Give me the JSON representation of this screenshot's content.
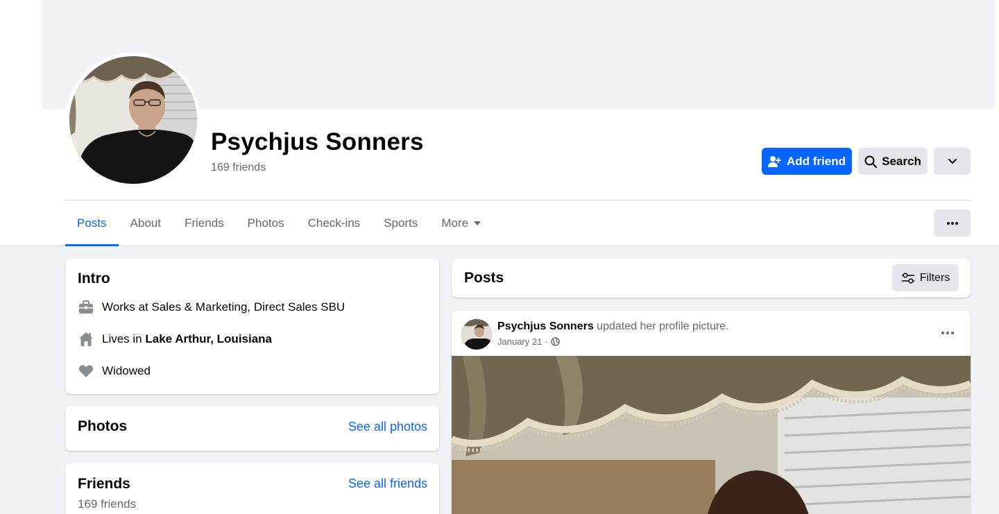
{
  "profile": {
    "name": "Psychjus Sonners",
    "friends_count": "169 friends"
  },
  "actions": {
    "add_friend": "Add friend",
    "search": "Search"
  },
  "tabs": [
    {
      "label": "Posts",
      "active": true
    },
    {
      "label": "About",
      "active": false
    },
    {
      "label": "Friends",
      "active": false
    },
    {
      "label": "Photos",
      "active": false
    },
    {
      "label": "Check-ins",
      "active": false
    },
    {
      "label": "Sports",
      "active": false
    },
    {
      "label": "More",
      "active": false
    }
  ],
  "intro": {
    "title": "Intro",
    "work_prefix": "Works at Sales & Marketing, Direct Sales SBU",
    "lives_prefix": "Lives in ",
    "lives_place": "Lake Arthur, Louisiana",
    "relationship": "Widowed"
  },
  "photos_card": {
    "title": "Photos",
    "link": "See all photos"
  },
  "friends_card": {
    "title": "Friends",
    "link": "See all friends",
    "count": "169 friends"
  },
  "posts_header": {
    "title": "Posts",
    "filters": "Filters"
  },
  "post": {
    "author": "Psychjus Sonners",
    "action": " updated her profile picture.",
    "date": "January 21",
    "separator": "·",
    "privacy_icon": "globe-icon"
  },
  "colors": {
    "accent": "#0866ff",
    "secondary_text": "#65676b",
    "button_grey": "#e4e6eb",
    "page_bg": "#f0f2f5"
  }
}
